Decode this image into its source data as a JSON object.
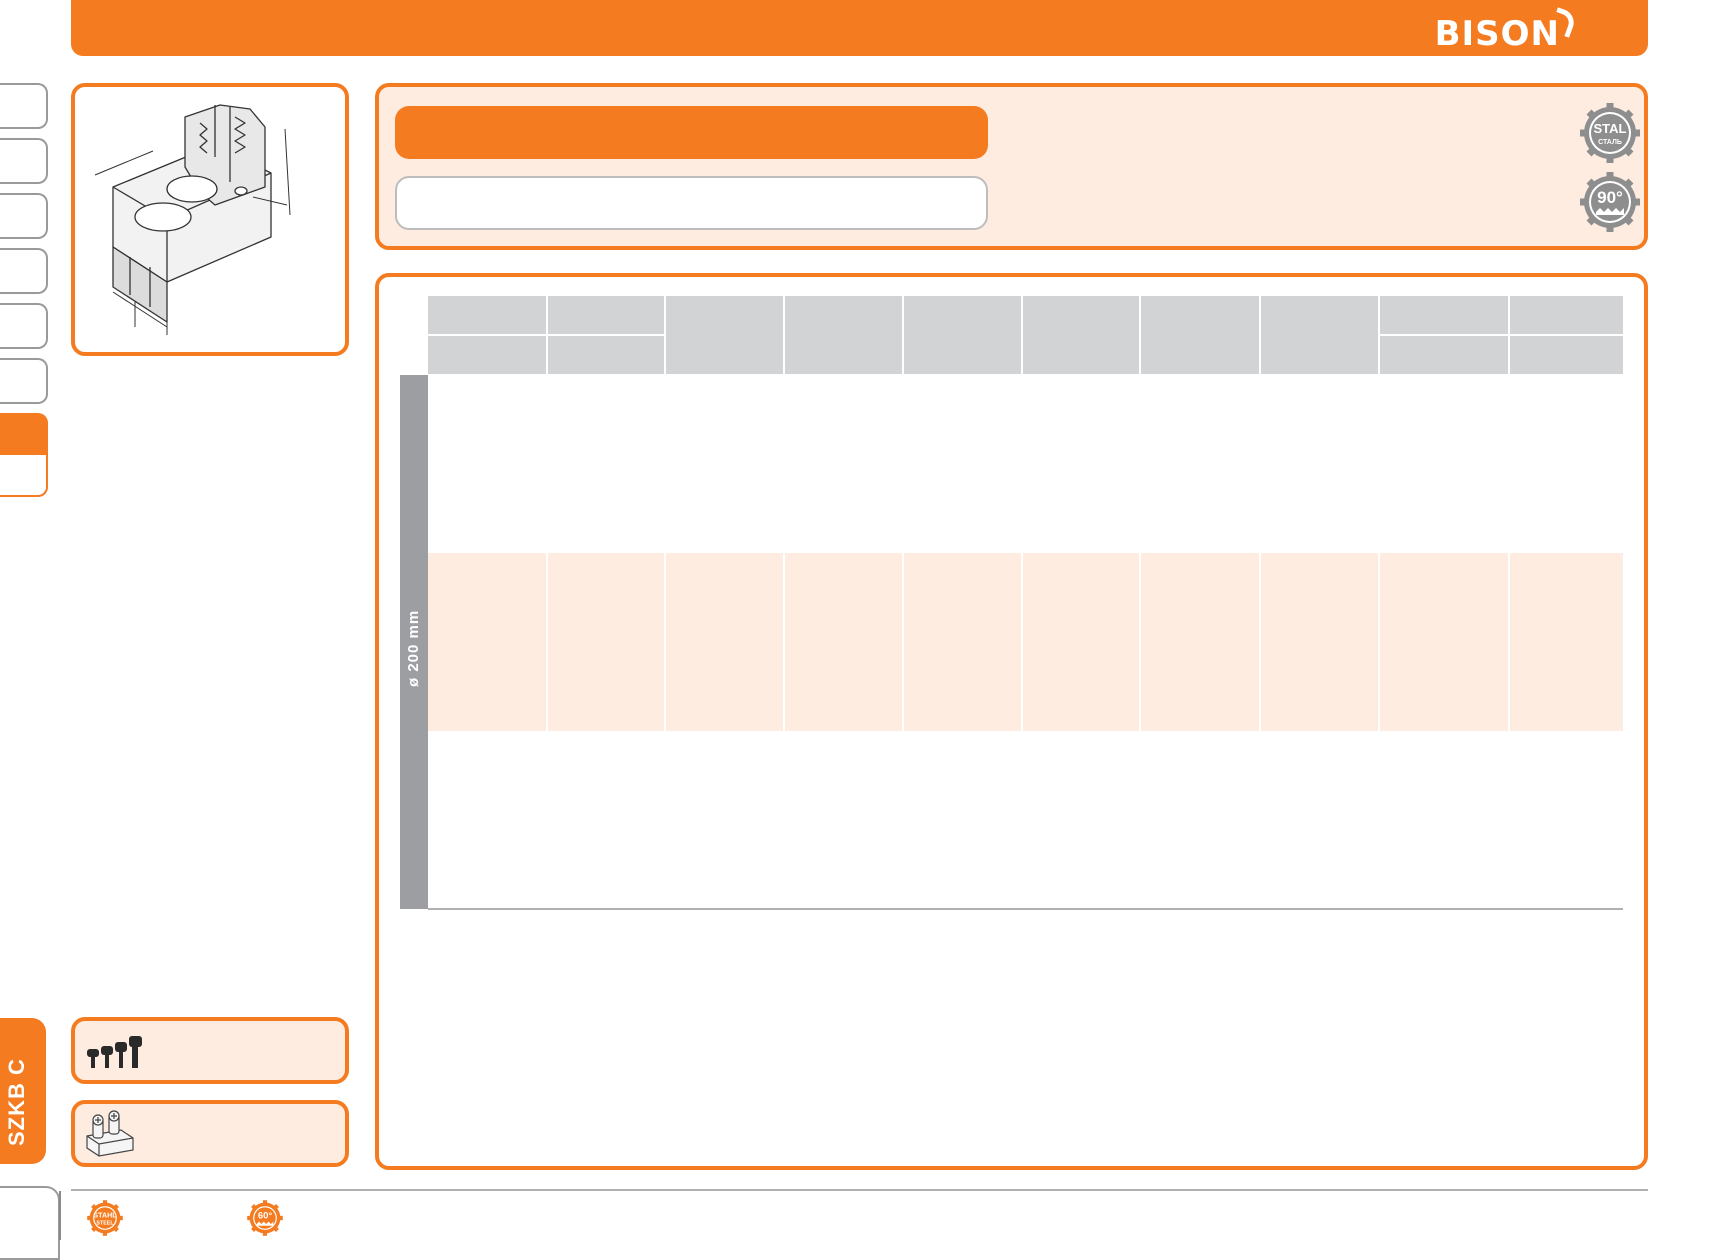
{
  "header": {
    "brand": "BISON"
  },
  "badges": {
    "top": {
      "line1": "STAL",
      "line2": "СТАЛЬ"
    },
    "bottom": {
      "angle": "90°"
    }
  },
  "table": {
    "diameter_label": "ø 200 mm"
  },
  "sidebar": {
    "section_label": "SZKB C"
  },
  "footer": {
    "badge1": {
      "line1": "STAHL",
      "line2": "STEEL"
    },
    "badge2": {
      "angle": "60°"
    }
  },
  "colors": {
    "accent": "#f47b20",
    "peach": "#feece0",
    "header_gray": "#d1d3d4",
    "side_gray": "#9d9ea1"
  },
  "icons": [
    "bison-horn-logo",
    "stal-steel-gear-badge",
    "angle-90-gear-badge",
    "jaw-drawing",
    "screws-icon",
    "t-nut-icon",
    "stahl-steel-gear-badge",
    "angle-60-gear-badge"
  ]
}
